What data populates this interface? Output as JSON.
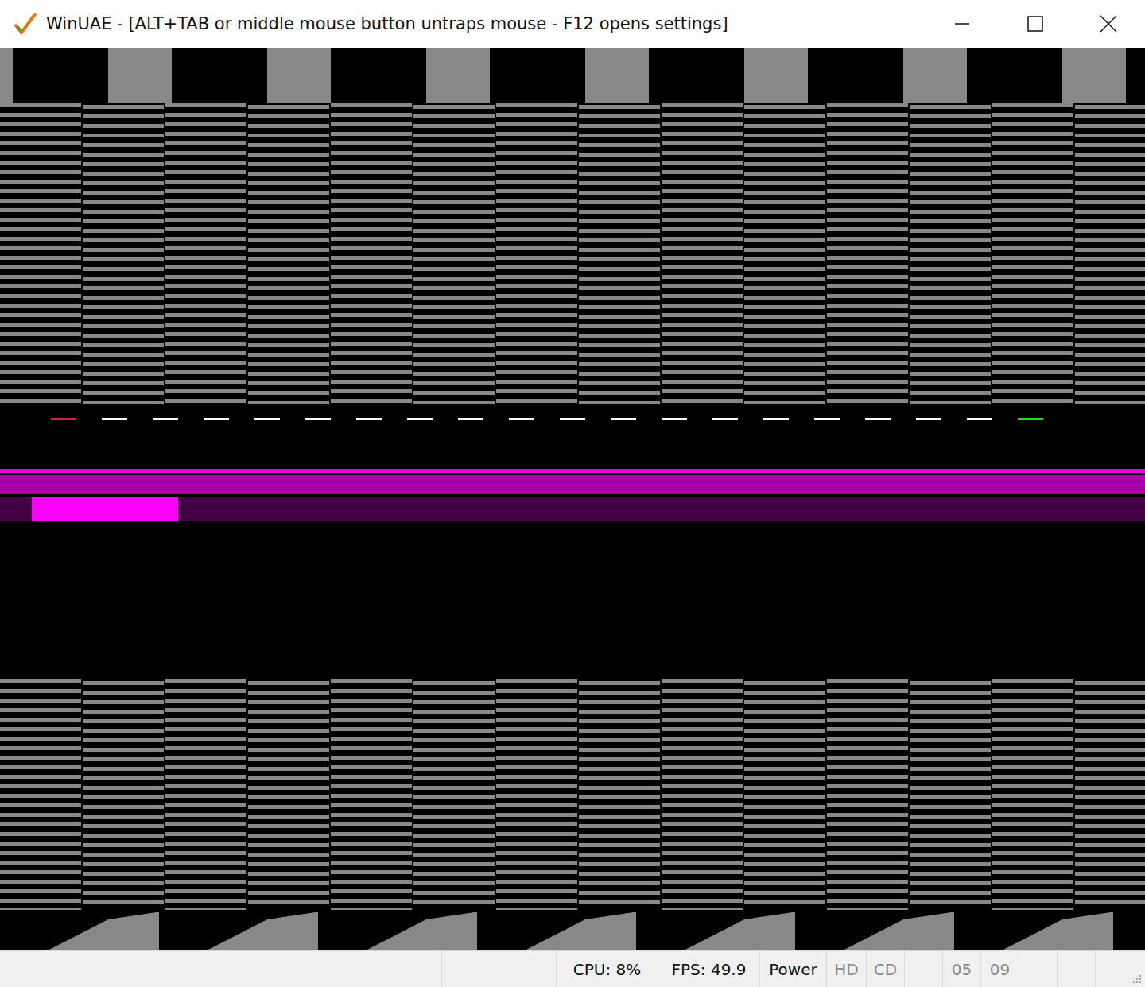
{
  "window": {
    "title": "WinUAE - [ALT+TAB or middle mouse button untraps mouse - F12 opens settings]"
  },
  "display": {
    "markers": [
      {
        "color": "#e02020"
      },
      {
        "color": "#ffffff"
      },
      {
        "color": "#ffffff"
      },
      {
        "color": "#ffffff"
      },
      {
        "color": "#ffffff"
      },
      {
        "color": "#ffffff"
      },
      {
        "color": "#ffffff"
      },
      {
        "color": "#ffffff"
      },
      {
        "color": "#ffffff"
      },
      {
        "color": "#ffffff"
      },
      {
        "color": "#ffffff"
      },
      {
        "color": "#ffffff"
      },
      {
        "color": "#ffffff"
      },
      {
        "color": "#ffffff"
      },
      {
        "color": "#ffffff"
      },
      {
        "color": "#ffffff"
      },
      {
        "color": "#ffffff"
      },
      {
        "color": "#ffffff"
      },
      {
        "color": "#ffffff"
      },
      {
        "color": "#20e020"
      }
    ]
  },
  "status_bar": [
    {
      "text": "",
      "disabled": false
    },
    {
      "text": "",
      "disabled": false
    },
    {
      "text": "CPU: 8%",
      "disabled": false
    },
    {
      "text": "FPS: 49.9",
      "disabled": false
    },
    {
      "text": "Power",
      "disabled": false
    },
    {
      "text": "HD",
      "disabled": true
    },
    {
      "text": "CD",
      "disabled": true
    },
    {
      "text": "",
      "disabled": false
    },
    {
      "text": "05",
      "disabled": true
    },
    {
      "text": "09",
      "disabled": true
    },
    {
      "text": "",
      "disabled": false
    },
    {
      "text": "",
      "disabled": false
    }
  ]
}
